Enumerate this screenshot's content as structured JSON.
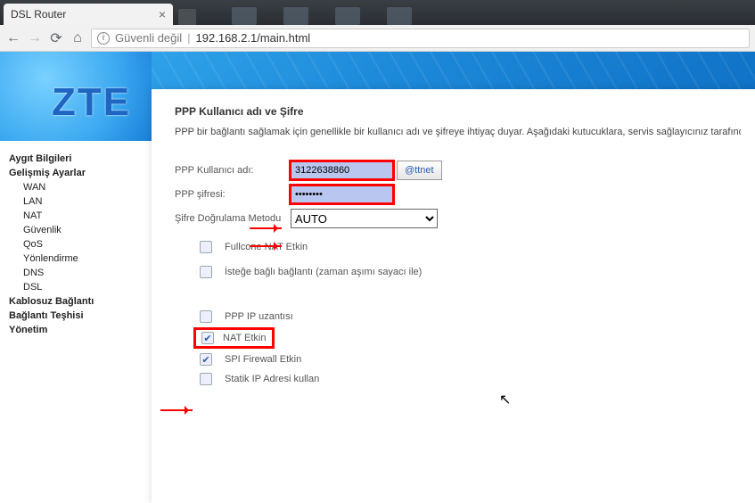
{
  "browser": {
    "tab_title": "DSL Router",
    "security_text": "Güvenli değil",
    "url": "192.168.2.1/main.html"
  },
  "logo": "ZTE",
  "sidebar": {
    "items": [
      {
        "label": "Aygıt Bilgileri",
        "bold": true,
        "sub": false
      },
      {
        "label": "Gelişmiş Ayarlar",
        "bold": true,
        "sub": false
      },
      {
        "label": "WAN",
        "bold": false,
        "sub": true
      },
      {
        "label": "LAN",
        "bold": false,
        "sub": true
      },
      {
        "label": "NAT",
        "bold": false,
        "sub": true
      },
      {
        "label": "Güvenlik",
        "bold": false,
        "sub": true
      },
      {
        "label": "QoS",
        "bold": false,
        "sub": true
      },
      {
        "label": "Yönlendirme",
        "bold": false,
        "sub": true
      },
      {
        "label": "DNS",
        "bold": false,
        "sub": true
      },
      {
        "label": "DSL",
        "bold": false,
        "sub": true
      },
      {
        "label": "Kablosuz Bağlantı",
        "bold": true,
        "sub": false
      },
      {
        "label": "Bağlantı Teşhisi",
        "bold": true,
        "sub": false
      },
      {
        "label": "Yönetim",
        "bold": true,
        "sub": false
      }
    ]
  },
  "panel": {
    "title": "PPP Kullanıcı adı ve Şifre",
    "desc": "PPP bir bağlantı sağlamak için genellikle bir kullanıcı adı ve şifreye ihtiyaç duyar. Aşağıdaki kutucuklara, servis sağlayıcınız tarafından verilen kullan",
    "username_label": "PPP Kullanıcı adı:",
    "username_value": "3122638860",
    "at_button": "@ttnet",
    "password_label": "PPP şifresi:",
    "password_value": "••••••••",
    "authmethod_label": "Şifre Doğrulama Metodu",
    "authmethod_value": "AUTO",
    "checks": {
      "fullcone": "Fullcone NAT Etkin",
      "ondemand": "İsteğe bağlı bağlantı (zaman aşımı sayacı ile)",
      "pppip": "PPP IP uzantısı",
      "nat": "NAT Etkin",
      "spi": "SPI Firewall Etkin",
      "staticip": "Statik IP Adresi kullan"
    }
  }
}
